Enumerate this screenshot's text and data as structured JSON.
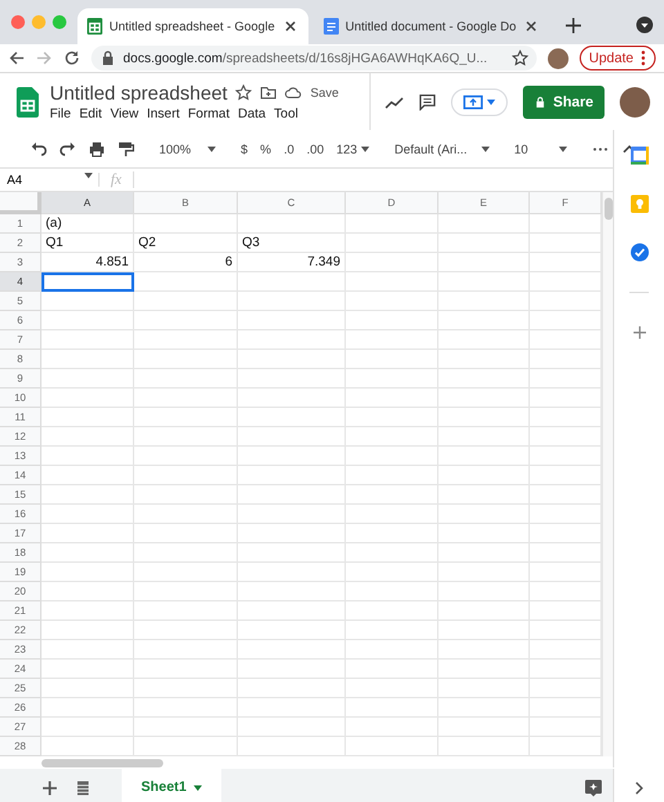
{
  "browser": {
    "tabs": [
      {
        "title": "Untitled spreadsheet - Google",
        "selected": true,
        "kind": "sheets"
      },
      {
        "title": "Untitled document - Google Do",
        "selected": false,
        "kind": "docs"
      }
    ],
    "url_host": "docs.google.com",
    "url_path": "/spreadsheets/d/16s8jHGA6AWHqKA6Q_U...",
    "update_button": "Update"
  },
  "document": {
    "title": "Untitled spreadsheet",
    "save_status": "Save",
    "menu": [
      "File",
      "Edit",
      "View",
      "Insert",
      "Format",
      "Data",
      "Tool"
    ],
    "share_button": "Share"
  },
  "toolbar": {
    "zoom": "100%",
    "currency": "$",
    "percent": "%",
    "decrease_decimals": ".0",
    "increase_decimals": ".00",
    "number_format": "123",
    "font": "Default (Ari...",
    "font_size": "10"
  },
  "formula_bar": {
    "cell_ref": "A4",
    "fx": "fx"
  },
  "sheet": {
    "columns": [
      {
        "label": "A",
        "selected": true
      },
      {
        "label": "B",
        "selected": false
      },
      {
        "label": "C",
        "selected": false
      },
      {
        "label": "D",
        "selected": false
      },
      {
        "label": "E",
        "selected": false
      },
      {
        "label": "F",
        "selected": false
      }
    ],
    "rows": [
      {
        "number": "1",
        "selected": false,
        "cells": [
          {
            "value": "(a)",
            "kind": "text"
          }
        ]
      },
      {
        "number": "2",
        "selected": false,
        "cells": [
          {
            "value": "Q1",
            "kind": "text"
          },
          {
            "value": "Q2",
            "kind": "text"
          },
          {
            "value": "Q3",
            "kind": "text"
          }
        ]
      },
      {
        "number": "3",
        "selected": false,
        "cells": [
          {
            "value": "4.851",
            "kind": "number"
          },
          {
            "value": "6",
            "kind": "number"
          },
          {
            "value": "7.349",
            "kind": "number"
          }
        ]
      },
      {
        "number": "4",
        "selected": true
      },
      {
        "number": "5",
        "selected": false
      },
      {
        "number": "6",
        "selected": false
      },
      {
        "number": "7",
        "selected": false
      },
      {
        "number": "8",
        "selected": false
      },
      {
        "number": "9",
        "selected": false
      },
      {
        "number": "10",
        "selected": false
      },
      {
        "number": "11",
        "selected": false
      },
      {
        "number": "12",
        "selected": false
      },
      {
        "number": "13",
        "selected": false
      },
      {
        "number": "14",
        "selected": false
      },
      {
        "number": "15",
        "selected": false
      },
      {
        "number": "16",
        "selected": false
      },
      {
        "number": "17",
        "selected": false
      },
      {
        "number": "18",
        "selected": false
      },
      {
        "number": "19",
        "selected": false
      },
      {
        "number": "20",
        "selected": false
      },
      {
        "number": "21",
        "selected": false
      },
      {
        "number": "22",
        "selected": false
      },
      {
        "number": "23",
        "selected": false
      },
      {
        "number": "24",
        "selected": false
      },
      {
        "number": "25",
        "selected": false
      },
      {
        "number": "26",
        "selected": false
      },
      {
        "number": "27",
        "selected": false
      },
      {
        "number": "28",
        "selected": false
      }
    ]
  },
  "sheet_tabs": [
    {
      "label": "Sheet1",
      "selected": true
    }
  ]
}
